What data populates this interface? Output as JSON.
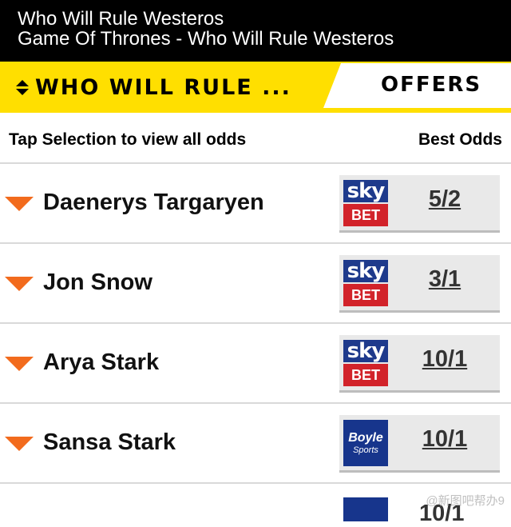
{
  "header": {
    "title": "Who Will Rule Westeros",
    "subtitle": "Game Of Thrones - Who Will Rule Westeros"
  },
  "tabs": {
    "market_label": "WHO WILL RULE ...",
    "offers_label": "OFFERS"
  },
  "columns": {
    "left": "Tap Selection to view all odds",
    "right": "Best Odds"
  },
  "selections": [
    {
      "name": "Daenerys Targaryen",
      "bookmaker": "Sky Bet",
      "logo_top": "sky",
      "logo_bottom": "BET",
      "odds": "5/2"
    },
    {
      "name": "Jon Snow",
      "bookmaker": "Sky Bet",
      "logo_top": "sky",
      "logo_bottom": "BET",
      "odds": "3/1"
    },
    {
      "name": "Arya Stark",
      "bookmaker": "Sky Bet",
      "logo_top": "sky",
      "logo_bottom": "BET",
      "odds": "10/1"
    },
    {
      "name": "Sansa Stark",
      "bookmaker": "BoyleSports",
      "logo_top": "Boyle",
      "logo_bottom": "Sports",
      "odds": "10/1"
    }
  ],
  "partial_row_odds": "10/1",
  "watermark": "@新图吧帮办9",
  "colors": {
    "top_bar": "#000000",
    "tab_bar": "#ffdf00",
    "arrow": "#f26b1d",
    "sky_blue": "#1e3a8c",
    "sky_red": "#d2232a",
    "boyle_blue": "#17358c"
  }
}
